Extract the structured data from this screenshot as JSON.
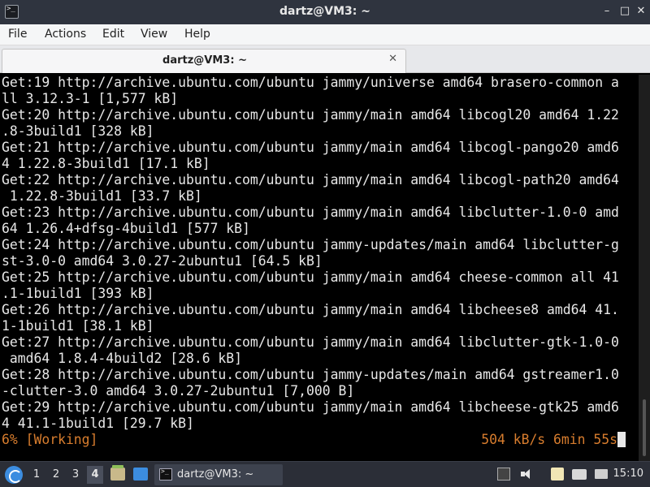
{
  "window": {
    "title": "dartz@VM3: ~",
    "controls": {
      "minimize": "–",
      "maximize": "□",
      "close": "✕"
    }
  },
  "menu": [
    "File",
    "Actions",
    "Edit",
    "View",
    "Help"
  ],
  "tab": {
    "label": "dartz@VM3: ~",
    "close": "✕"
  },
  "terminal": {
    "lines": [
      "Get:19 http://archive.ubuntu.com/ubuntu jammy/universe amd64 brasero-common a",
      "ll 3.12.3-1 [1,577 kB]",
      "Get:20 http://archive.ubuntu.com/ubuntu jammy/main amd64 libcogl20 amd64 1.22",
      ".8-3build1 [328 kB]",
      "Get:21 http://archive.ubuntu.com/ubuntu jammy/main amd64 libcogl-pango20 amd6",
      "4 1.22.8-3build1 [17.1 kB]",
      "Get:22 http://archive.ubuntu.com/ubuntu jammy/main amd64 libcogl-path20 amd64",
      " 1.22.8-3build1 [33.7 kB]",
      "Get:23 http://archive.ubuntu.com/ubuntu jammy/main amd64 libclutter-1.0-0 amd",
      "64 1.26.4+dfsg-4build1 [577 kB]",
      "Get:24 http://archive.ubuntu.com/ubuntu jammy-updates/main amd64 libclutter-g",
      "st-3.0-0 amd64 3.0.27-2ubuntu1 [64.5 kB]",
      "Get:25 http://archive.ubuntu.com/ubuntu jammy/main amd64 cheese-common all 41",
      ".1-1build1 [393 kB]",
      "Get:26 http://archive.ubuntu.com/ubuntu jammy/main amd64 libcheese8 amd64 41.",
      "1-1build1 [38.1 kB]",
      "Get:27 http://archive.ubuntu.com/ubuntu jammy/main amd64 libclutter-gtk-1.0-0",
      " amd64 1.8.4-4build2 [28.6 kB]",
      "Get:28 http://archive.ubuntu.com/ubuntu jammy-updates/main amd64 gstreamer1.0",
      "-clutter-3.0 amd64 3.0.27-2ubuntu1 [7,000 B]",
      "Get:29 http://archive.ubuntu.com/ubuntu jammy/main amd64 libcheese-gtk25 amd6",
      "4 41.1-1build1 [29.7 kB]"
    ],
    "status_left": "6% [Working]",
    "status_right": "504 kB/s 6min 55s",
    "status_color": "#d87d2e"
  },
  "taskbar": {
    "workspaces": [
      "1",
      "2",
      "3",
      "4"
    ],
    "active_workspace": "4",
    "task_label": "dartz@VM3: ~",
    "clock": "15:10"
  }
}
